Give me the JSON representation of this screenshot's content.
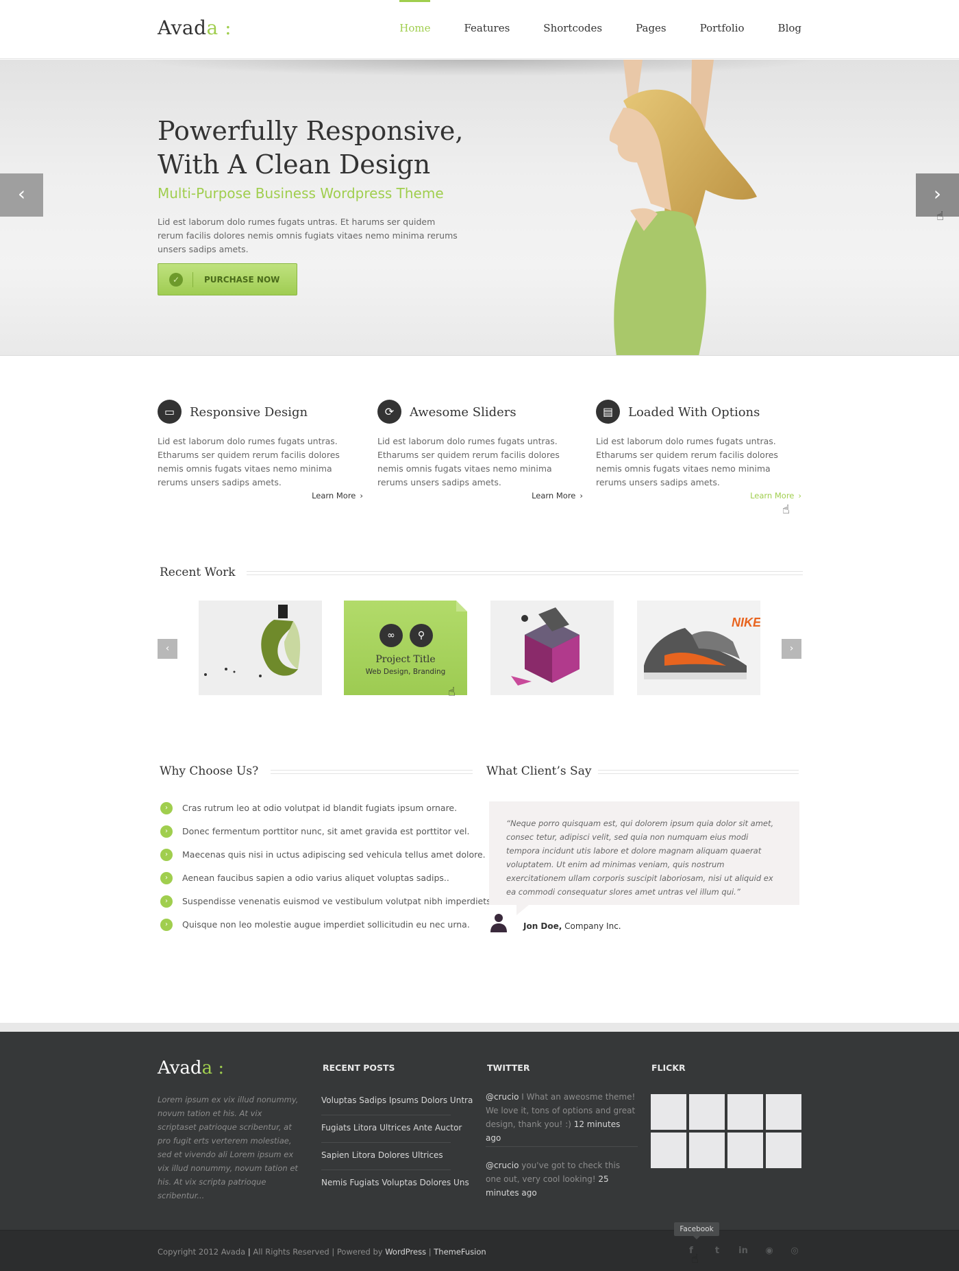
{
  "header": {
    "logo_text": "Avad",
    "logo_accent": "a",
    "logo_colon": " :",
    "nav": [
      "Home",
      "Features",
      "Shortcodes",
      "Pages",
      "Portfolio",
      "Blog"
    ],
    "active_nav": "Home"
  },
  "hero": {
    "title_line1": "Powerfully Responsive,",
    "title_line2": "With A Clean Design",
    "subtitle": "Multi-Purpose Business Wordpress Theme",
    "text": "Lid est laborum dolo rumes fugats untras. Et harums ser quidem rerum facilis dolores nemis omnis fugiats vitaes nemo minima rerums unsers sadips amets.",
    "button_label": "PURCHASE NOW",
    "prev_icon": "chevron-left-icon",
    "next_icon": "chevron-right-icon"
  },
  "features": [
    {
      "title": "Responsive Design",
      "icon": "laptop-icon",
      "text": "Lid est laborum dolo rumes fugats untras. Etharums ser quidem rerum facilis dolores nemis omnis fugats vitaes nemo minima rerums unsers sadips amets.",
      "link": "Learn More"
    },
    {
      "title": "Awesome Sliders",
      "icon": "refresh-icon",
      "text": "Lid est laborum dolo rumes fugats untras. Etharums ser quidem rerum facilis dolores nemis omnis fugats vitaes nemo minima rerums unsers sadips amets.",
      "link": "Learn More"
    },
    {
      "title": "Loaded With Options",
      "icon": "options-icon",
      "text": "Lid est laborum dolo rumes fugats untras. Etharums ser quidem rerum facilis dolores nemis omnis fugats vitaes nemo minima rerums unsers sadips amets.",
      "link": "Learn More"
    }
  ],
  "recent_work": {
    "title": "Recent Work",
    "hover_item": {
      "title": "Project Title",
      "category": "Web Design, Branding"
    }
  },
  "why_choose": {
    "title": "Why Choose Us?",
    "items": [
      "Cras rutrum leo at odio volutpat id blandit fugiats ipsum ornare.",
      "Donec fermentum porttitor nunc, sit amet gravida est porttitor vel.",
      "Maecenas quis nisi in uctus adipiscing sed vehicula tellus amet dolore.",
      "Aenean faucibus sapien a odio varius aliquet voluptas sadips..",
      "Suspendisse venenatis euismod ve vestibulum volutpat nibh imperdiets.",
      "Quisque non leo molestie augue imperdiet sollicitudin eu nec urna."
    ]
  },
  "testimonial": {
    "title": "What Client’s Say",
    "quote": "“Neque porro quisquam est, qui dolorem ipsum quia dolor sit amet, consec tetur, adipisci velit, sed quia non numquam eius modi tempora incidunt utis labore et dolore magnam aliquam quaerat voluptatem. Ut enim ad minimas veniam, quis nostrum exercitationem ullam corporis suscipit laboriosam, nisi ut aliquid ex ea commodi consequatur slores amet untras vel illum qui.”",
    "name": "Jon Doe,",
    "company": " Company Inc."
  },
  "footer": {
    "logo_text": "Avad",
    "logo_accent": "a",
    "logo_colon": " :",
    "about": "Lorem ipsum ex vix illud nonummy, novum tation et his. At vix scriptaset patrioque scribentur, at pro fugit erts verterem molestiae, sed et vivendo ali Lorem ipsum ex vix illud nonummy, novum tation et his. At vix scripta patrioque scribentur...",
    "recent_posts_title": "RECENT POSTS",
    "recent_posts": [
      "Voluptas Sadips Ipsums Dolors Untra",
      "Fugiats Litora Ultrices Ante Auctor",
      "Sapien Litora Dolores Ultrices",
      "Nemis Fugiats Voluptas Dolores Uns"
    ],
    "twitter_title": "TWITTER",
    "tweets": [
      {
        "handle": "@crucio",
        "text": " I What an aweosme theme! We love it, tons of options and great design, thank you!  :)",
        "time": " 12 minutes ago"
      },
      {
        "handle": "@crucio",
        "text": " you've got to check this one out, very cool looking!",
        "time": " 25 minutes ago"
      }
    ],
    "flickr_title": "FLICKR"
  },
  "copyright": {
    "part1": "Copyright 2012 Avada",
    "sep1": " | ",
    "part2": " All Rights Reserved   |   Powered by ",
    "wp": "WordPress",
    "sep2": "   |   ",
    "tf": "ThemeFusion",
    "tooltip": "Facebook",
    "social_icons": [
      "facebook-icon",
      "twitter-icon",
      "linkedin-icon",
      "rss-icon",
      "dribbble-icon"
    ]
  },
  "colors": {
    "accent": "#a0ce4e",
    "dark": "#333333",
    "footer_bg": "#363839"
  }
}
